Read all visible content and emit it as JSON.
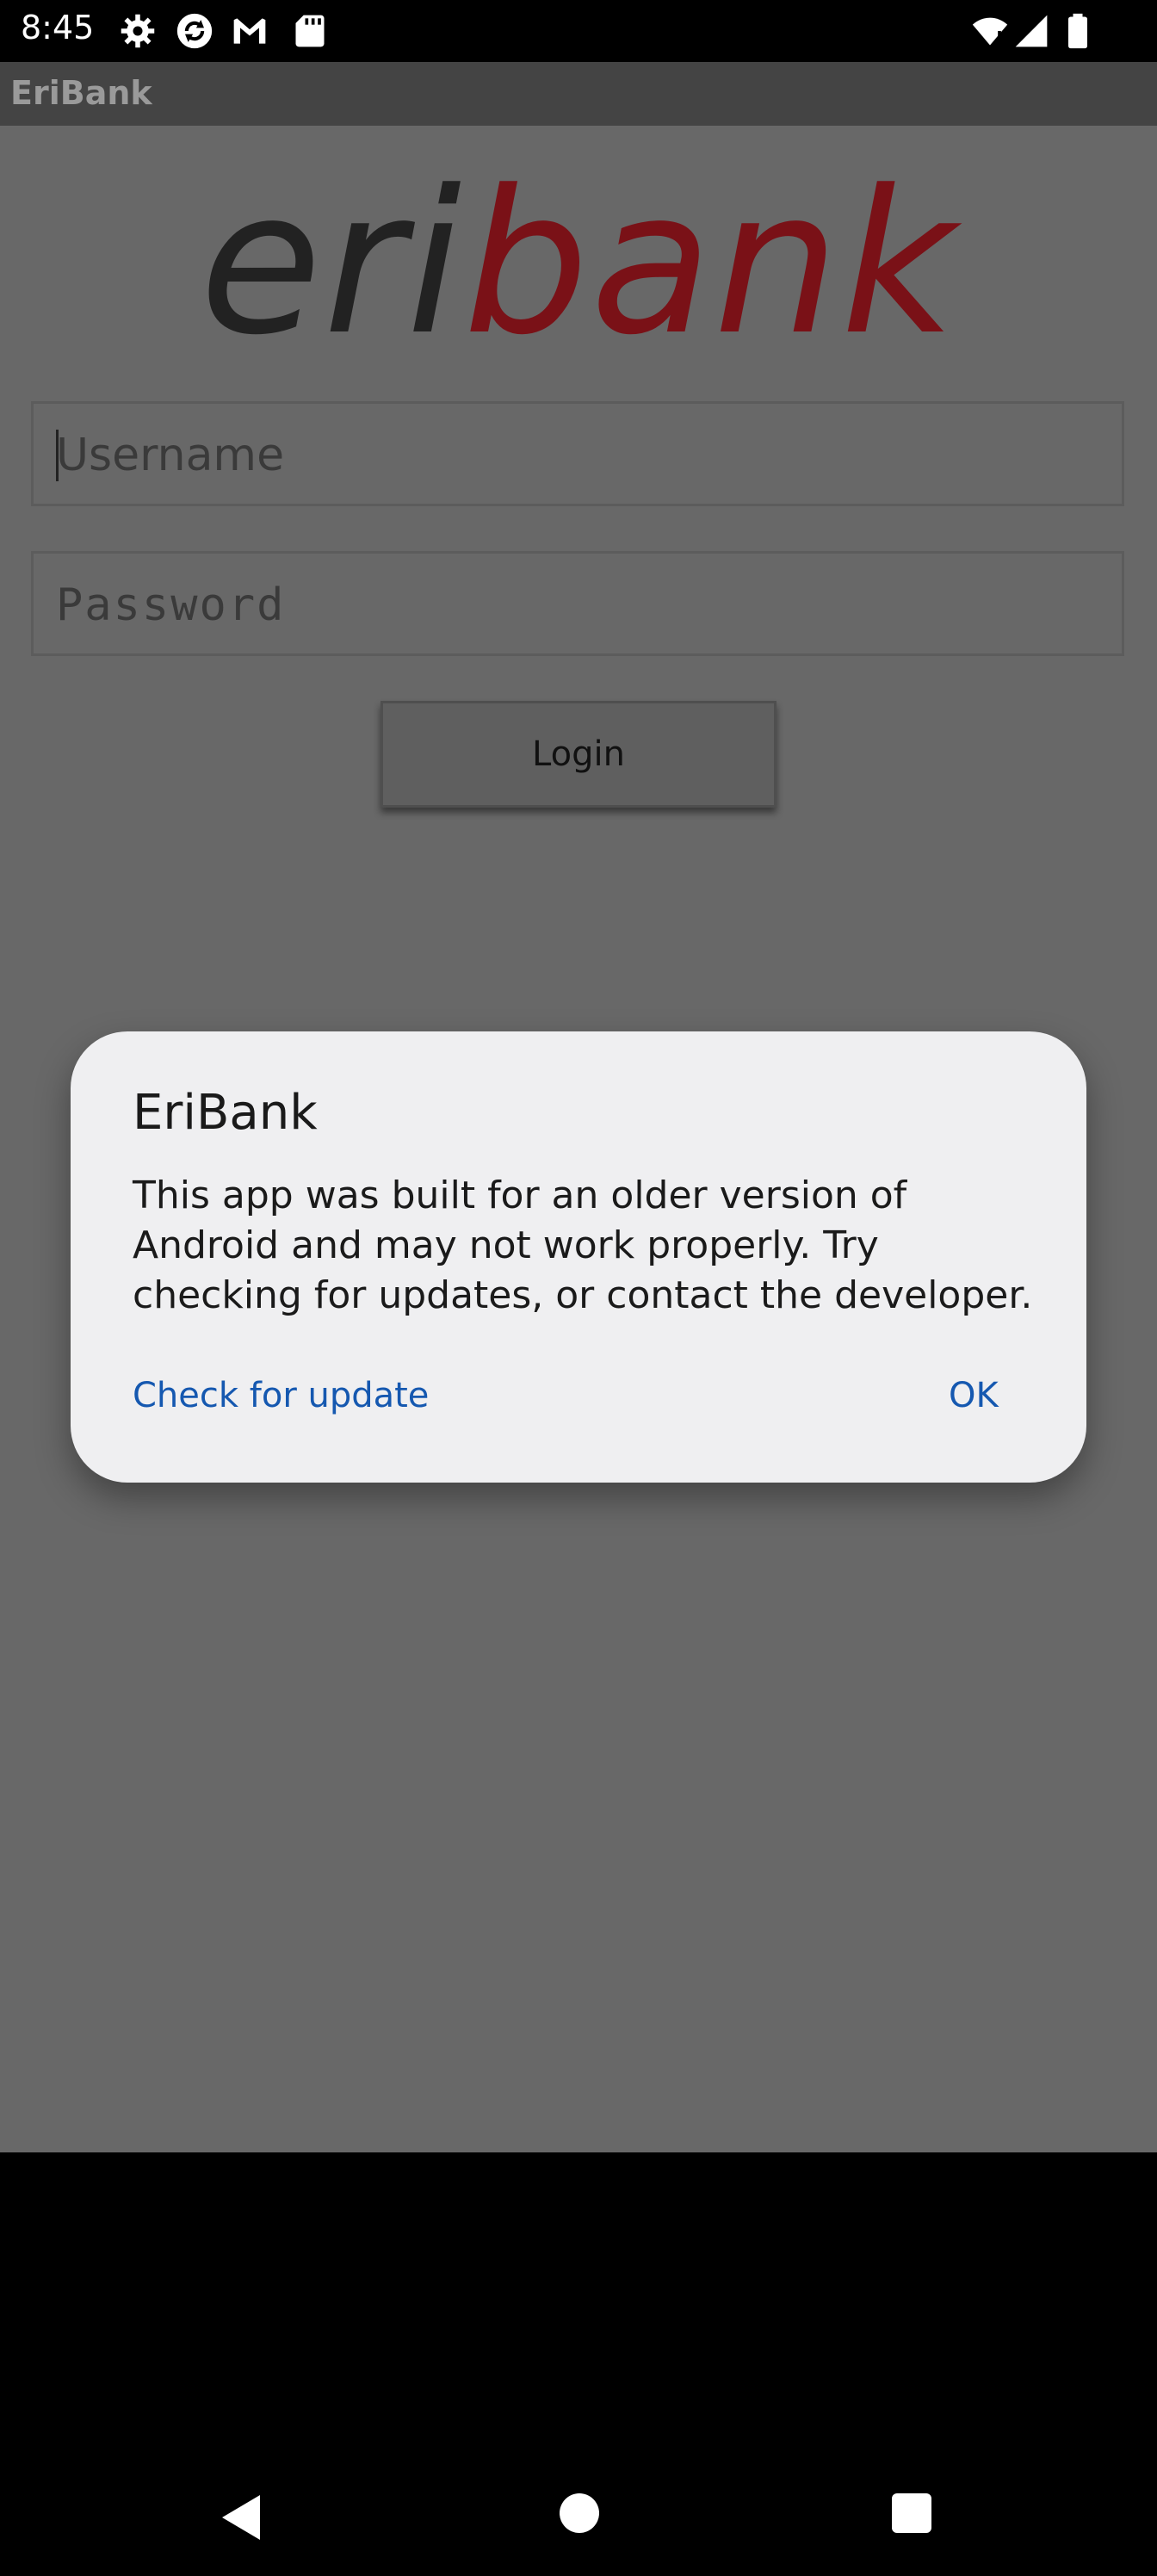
{
  "status_bar": {
    "time": "8:45",
    "left_icons": [
      "settings-icon",
      "sync-icon",
      "gmail-icon",
      "sd-card-icon"
    ],
    "right_icons": [
      "wifi-icon",
      "signal-icon",
      "battery-icon"
    ]
  },
  "app_bar": {
    "title": "EriBank"
  },
  "login": {
    "logo_part1": "eri",
    "logo_part2": "bank",
    "username_placeholder": "Username",
    "password_placeholder": "Password",
    "login_label": "Login"
  },
  "dialog": {
    "title": "EriBank",
    "message": "This app was built for an older version of Android and may not work properly. Try checking for updates, or contact the developer.",
    "check_update_label": "Check for update",
    "ok_label": "OK"
  },
  "nav_bar": {
    "icons": [
      "back-icon",
      "home-icon",
      "recents-icon"
    ]
  },
  "colors": {
    "accent": "#1558b0",
    "logo_red": "#7a1117",
    "scrim_background": "#686868"
  }
}
